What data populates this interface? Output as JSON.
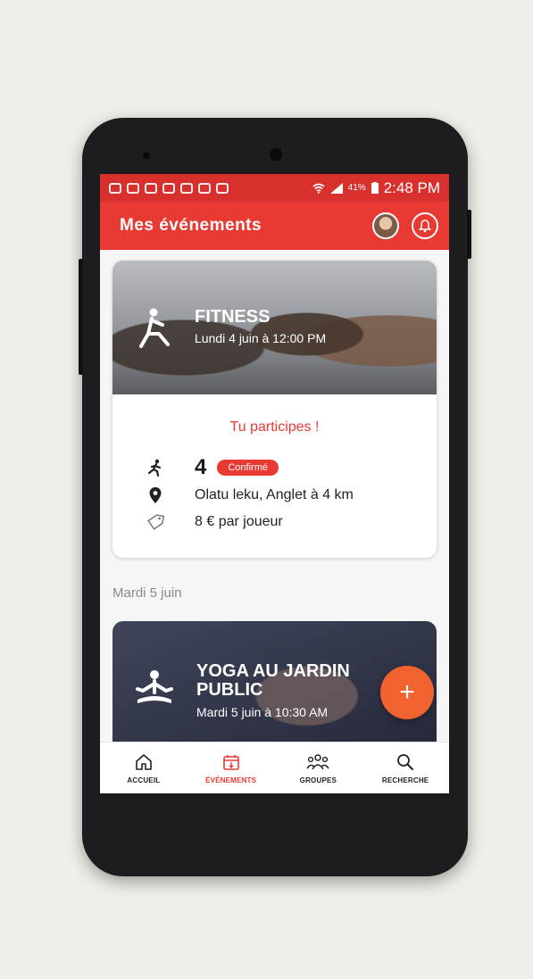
{
  "status_bar": {
    "battery": "41%",
    "time": "2:48 PM"
  },
  "header": {
    "title": "Mes événements"
  },
  "event_card": {
    "title": "FITNESS",
    "datetime": "Lundi 4 juin à 12:00 PM",
    "participation": "Tu participes !",
    "count": "4",
    "status_badge": "Confirmé",
    "location": "Olatu leku, Anglet à 4 km",
    "price": "8 € par joueur"
  },
  "section_date": "Mardi 5 juin",
  "event_card_2": {
    "title": "YOGA AU JARDIN PUBLIC",
    "datetime": "Mardi 5 juin à 10:30 AM"
  },
  "fab": {
    "label": "+"
  },
  "bottom_nav": {
    "items": [
      {
        "label": "ACCUEIL",
        "icon": "home-icon"
      },
      {
        "label": "ÉVÉNEMENTS",
        "icon": "calendar-icon",
        "active": true
      },
      {
        "label": "GROUPES",
        "icon": "groups-icon"
      },
      {
        "label": "RECHERCHE",
        "icon": "search-icon"
      }
    ]
  },
  "colors": {
    "accent": "#e83a33",
    "fab": "#f0622e"
  }
}
